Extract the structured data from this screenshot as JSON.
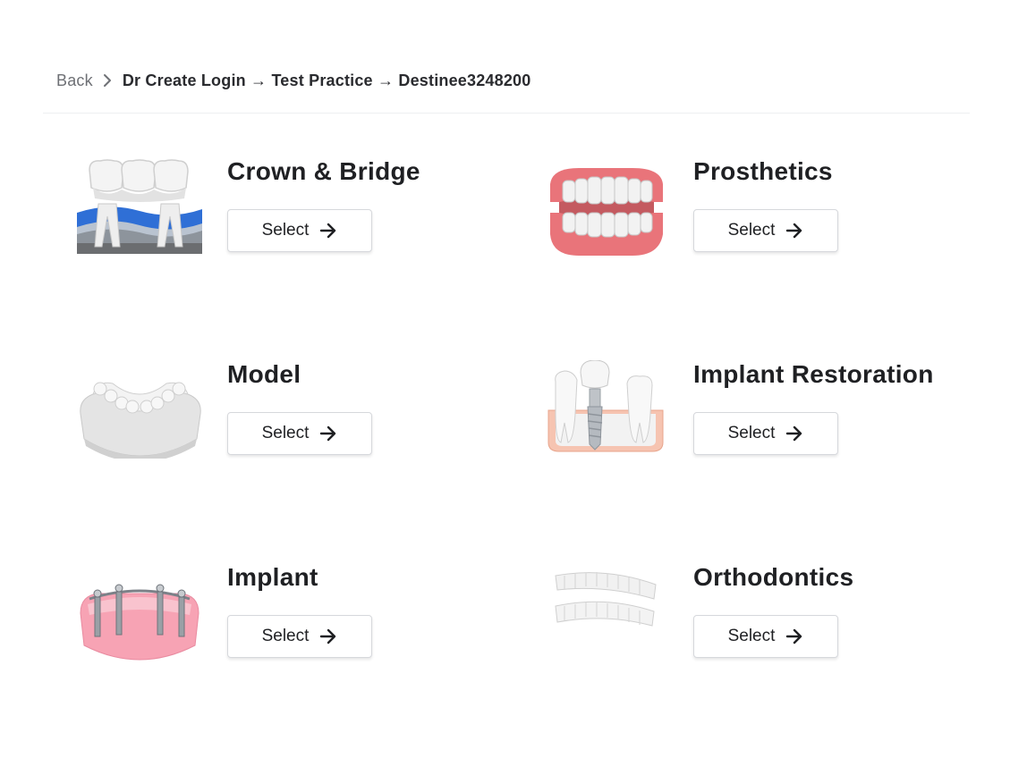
{
  "breadcrumb": {
    "back_label": "Back",
    "path": "Dr Create Login → Test Practice → Destinee3248200"
  },
  "categories": [
    {
      "title": "Crown & Bridge",
      "button_label": "Select",
      "icon": "crown-bridge-icon"
    },
    {
      "title": "Prosthetics",
      "button_label": "Select",
      "icon": "denture-icon"
    },
    {
      "title": "Model",
      "button_label": "Select",
      "icon": "dental-model-icon"
    },
    {
      "title": "Implant Restoration",
      "button_label": "Select",
      "icon": "implant-restoration-icon"
    },
    {
      "title": "Implant",
      "button_label": "Select",
      "icon": "implant-bar-icon"
    },
    {
      "title": "Orthodontics",
      "button_label": "Select",
      "icon": "clear-aligner-icon"
    }
  ]
}
